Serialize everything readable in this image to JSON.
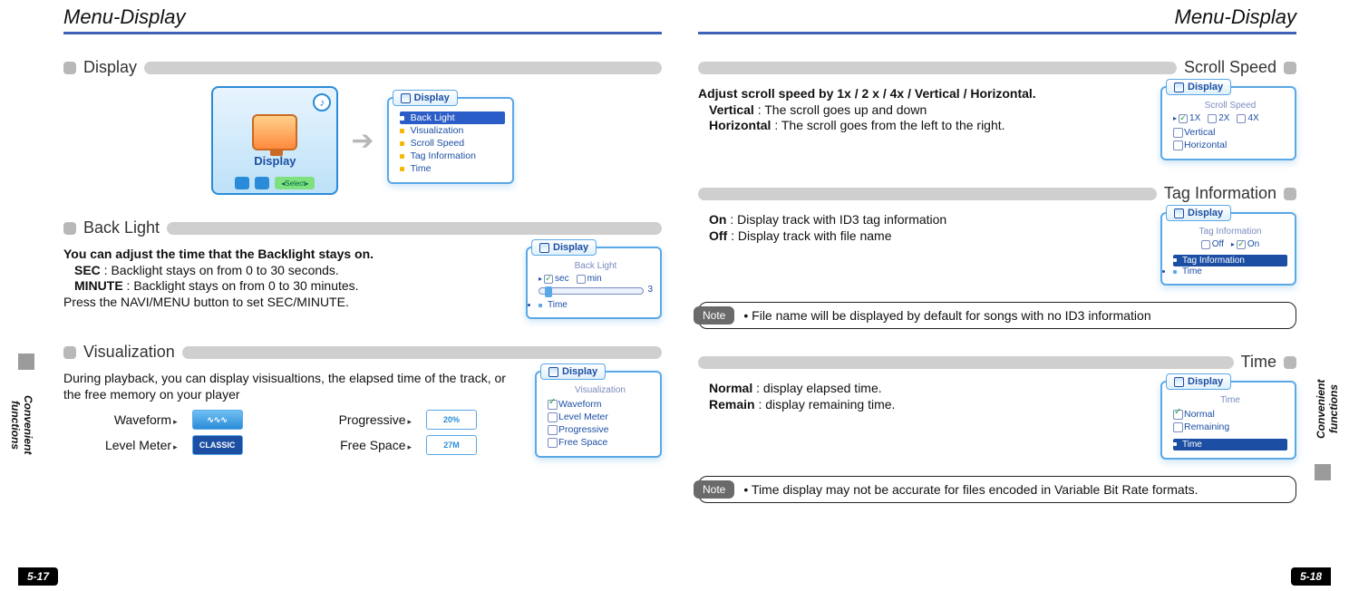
{
  "page_title": "Menu-Display",
  "side_label": "Convenient functions",
  "page_num_left": "5-17",
  "page_num_right": "5-18",
  "note_label": "Note",
  "panel_tab": "Display",
  "left": {
    "sec_display": "Display",
    "sec_backlight": "Back Light",
    "sec_visualization": "Visualization",
    "device_label": "Display",
    "menu_items": [
      "Back Light",
      "Visualization",
      "Scroll Speed",
      "Tag Information",
      "Time"
    ],
    "backlight": {
      "l1": "You can adjust the time that the Backlight stays on.",
      "l2a": "SEC",
      "l2b": " : Backlight stays on from 0 to 30 seconds.",
      "l3a": "MINUTE",
      "l3b": " : Backlight stays on from 0 to 30 minutes.",
      "l4": "Press the NAVI/MENU button to set SEC/MINUTE.",
      "panel_head": "Back Light",
      "opt_sec": "sec",
      "opt_min": "min",
      "slider_val": "3",
      "foot": "Time"
    },
    "visualization": {
      "l1": "During playback, you can display visisualtions, the elapsed time of the track, or the free memory on your player",
      "labels": {
        "waveform": "Waveform",
        "levelmeter": "Level Meter",
        "progressive": "Progressive",
        "freespace": "Free Space"
      },
      "chips": {
        "classic": "CLASSIC",
        "pct": "20%",
        "free": "27M"
      },
      "panel_head": "Visualization",
      "panel_items": [
        "Waveform",
        "Level Meter",
        "Progressive",
        "Free Space"
      ]
    }
  },
  "right": {
    "sec_scroll": "Scroll Speed",
    "sec_tag": "Tag Information",
    "sec_time": "Time",
    "scroll": {
      "l1": "Adjust scroll speed by 1x / 2 x / 4x / Vertical / Horizontal.",
      "l2a": "Vertical",
      "l2b": " : The scroll goes up and down",
      "l3a": "Horizontal",
      "l3b": " : The scroll goes from the left to the right.",
      "panel_head": "Scroll Speed",
      "opts": [
        "1X",
        "2X",
        "4X"
      ],
      "panel_items": [
        "Vertical",
        "Horizontal"
      ]
    },
    "tag": {
      "l1a": "On",
      "l1b": " : Display track with ID3 tag information",
      "l2a": "Off",
      "l2b": " : Display track with file name",
      "panel_head": "Tag Information",
      "opt_off": "Off",
      "opt_on": "On",
      "foot1": "Tag Information",
      "foot2": "Time",
      "note": "File name will be displayed by default for songs with no ID3 information"
    },
    "time": {
      "l1a": "Normal",
      "l1b": " : display elapsed time.",
      "l2a": "Remain",
      "l2b": " : display remaining time.",
      "panel_head": "Time",
      "panel_items": [
        "Normal",
        "Remaining"
      ],
      "foot": "Time",
      "note": "Time display may not be accurate for files encoded in Variable Bit Rate formats."
    }
  }
}
